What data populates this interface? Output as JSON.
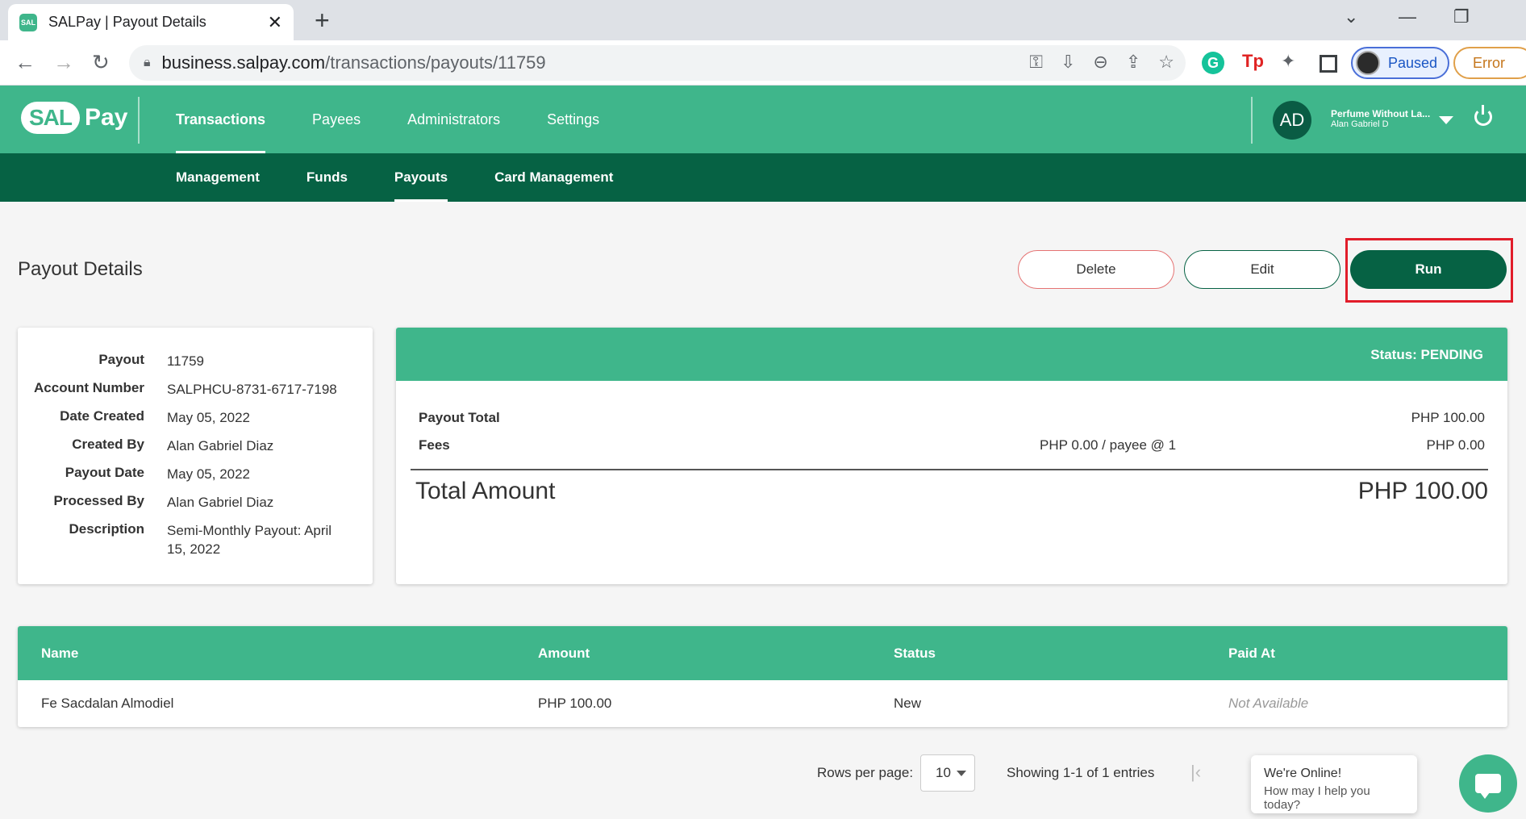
{
  "browser": {
    "tab_title": "SALPay | Payout Details",
    "tab_favicon_text": "SAL",
    "url_domain": "business.salpay.com",
    "url_path": "/transactions/payouts/11759",
    "profile_label": "Paused",
    "error_label": "Error",
    "extension_g": "G",
    "extension_tp": "Tp"
  },
  "header": {
    "logo_sal": "SAL",
    "logo_pay": "Pay",
    "nav": [
      {
        "label": "Transactions",
        "active": true
      },
      {
        "label": "Payees",
        "active": false
      },
      {
        "label": "Administrators",
        "active": false
      },
      {
        "label": "Settings",
        "active": false
      }
    ],
    "avatar_initials": "AD",
    "account_name": "Perfume Without La...",
    "account_user": "Alan Gabriel D"
  },
  "subnav": [
    {
      "label": "Management",
      "active": false
    },
    {
      "label": "Funds",
      "active": false
    },
    {
      "label": "Payouts",
      "active": true
    },
    {
      "label": "Card Management",
      "active": false
    }
  ],
  "page": {
    "title": "Payout Details",
    "buttons": {
      "delete": "Delete",
      "edit": "Edit",
      "run": "Run"
    }
  },
  "details": [
    {
      "label": "Payout",
      "value": "11759"
    },
    {
      "label": "Account Number",
      "value": "SALPHCU-8731-6717-7198"
    },
    {
      "label": "Date Created",
      "value": "May 05, 2022"
    },
    {
      "label": "Created By",
      "value": "Alan Gabriel Diaz"
    },
    {
      "label": "Payout Date",
      "value": "May 05, 2022"
    },
    {
      "label": "Processed By",
      "value": "Alan Gabriel Diaz"
    },
    {
      "label": "Description",
      "value": "Semi-Monthly Payout: April 15, 2022"
    }
  ],
  "summary": {
    "status": "Status: PENDING",
    "payout_total_label": "Payout Total",
    "payout_total_value": "PHP 100.00",
    "fees_label": "Fees",
    "fees_rate": "PHP 0.00 / payee @ 1",
    "fees_value": "PHP 0.00",
    "total_label": "Total Amount",
    "total_value": "PHP 100.00"
  },
  "table": {
    "headers": [
      "Name",
      "Amount",
      "Status",
      "Paid At"
    ],
    "rows": [
      [
        "Fe Sacdalan Almodiel",
        "PHP 100.00",
        "New",
        "Not Available"
      ]
    ]
  },
  "pagination": {
    "rows_per_page_label": "Rows per page:",
    "rows_per_page_value": "10",
    "showing": "Showing 1-1 of 1 entries"
  },
  "chat": {
    "title": "We're Online!",
    "subtitle": "How may I help you today?"
  },
  "colors": {
    "brand_green": "#3fb68b",
    "dark_green": "#066244",
    "highlight_red": "#e11d2a"
  }
}
